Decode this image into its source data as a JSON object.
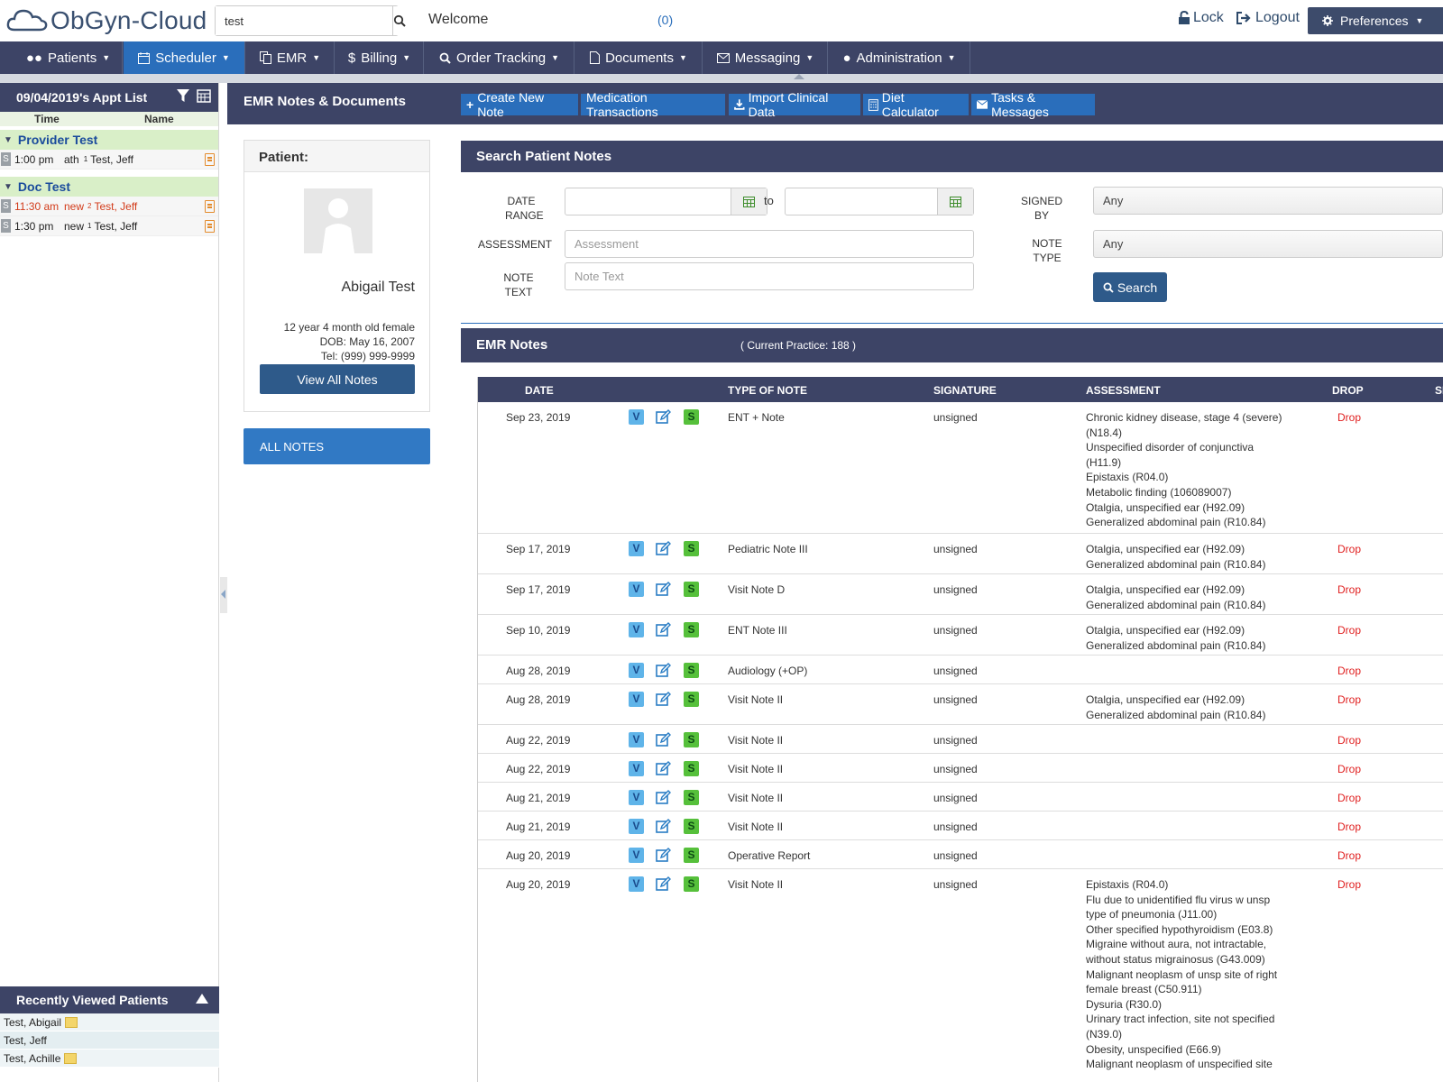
{
  "app": {
    "logo_text": "ObGyn-Cloud"
  },
  "header": {
    "search_value": "test",
    "welcome": "Welcome",
    "messages": "(0)",
    "lock": "Lock",
    "logout": "Logout",
    "preferences": "Preferences"
  },
  "nav": {
    "patients": "Patients",
    "scheduler": "Scheduler",
    "emr": "EMR",
    "billing": "Billing",
    "order_tracking": "Order Tracking",
    "documents": "Documents",
    "messaging": "Messaging",
    "administration": "Administration"
  },
  "sidebar": {
    "title": "09/04/2019's Appt List",
    "col_time": "Time",
    "col_name": "Name",
    "groups": [
      {
        "name": "Provider Test",
        "rows": [
          {
            "time": "1:00 pm",
            "type": "ath",
            "sup": "1",
            "patient": "Test, Jeff",
            "red": false
          }
        ]
      },
      {
        "name": "Doc Test",
        "rows": [
          {
            "time": "11:30 am",
            "type": "new",
            "sup": "2",
            "patient": "Test, Jeff",
            "red": true
          },
          {
            "time": "1:30 pm",
            "type": "new",
            "sup": "1",
            "patient": "Test, Jeff",
            "red": false
          }
        ]
      }
    ],
    "recent_title": "Recently Viewed Patients",
    "recent": [
      "Test, Abigail",
      "Test, Jeff",
      "Test, Achille"
    ]
  },
  "main": {
    "title": "EMR Notes & Documents",
    "toolbar": {
      "create": "Create New Note",
      "medication": "Medication Transactions",
      "import": "Import Clinical Data",
      "diet": "Diet Calculator",
      "tasks": "Tasks & Messages"
    }
  },
  "patient": {
    "header": "Patient:",
    "name": "Abigail Test",
    "age": "12 year 4 month old female",
    "dob": "DOB: May 16, 2007",
    "tel": "Tel: (999) 999-9999",
    "view_all": "View All Notes",
    "all_notes": "ALL NOTES"
  },
  "search": {
    "title": "Search Patient Notes",
    "date_label_1": "DATE",
    "date_label_2": "RANGE",
    "to": "to",
    "assessment_label": "ASSESSMENT",
    "assessment_placeholder": "Assessment",
    "note_label_1": "NOTE",
    "note_label_2": "TEXT",
    "note_placeholder": "Note Text",
    "signed_label_1": "SIGNED",
    "signed_label_2": "BY",
    "signed_value": "Any",
    "type_label_1": "NOTE",
    "type_label_2": "TYPE",
    "type_value": "Any",
    "button": "Search"
  },
  "emr": {
    "title": "EMR Notes",
    "practice": "( Current Practice: 188 )",
    "columns": {
      "date": "DATE",
      "type": "TYPE OF NOTE",
      "signature": "SIGNATURE",
      "assessment": "ASSESSMENT",
      "drop": "DROP",
      "s": "SI"
    },
    "rows": [
      {
        "date": "Sep 23, 2019",
        "type": "ENT + Note",
        "signature": "unsigned",
        "drop": "Drop",
        "assessment": [
          "Chronic kidney disease, stage 4 (severe)",
          "(N18.4)",
          "Unspecified disorder of conjunctiva",
          "(H11.9)",
          "Epistaxis (R04.0)",
          "Metabolic finding (106089007)",
          "Otalgia, unspecified ear (H92.09)",
          "Generalized abdominal pain (R10.84)"
        ]
      },
      {
        "date": "Sep 17, 2019",
        "type": "Pediatric Note III",
        "signature": "unsigned",
        "drop": "Drop",
        "assessment": [
          "Otalgia, unspecified ear (H92.09)",
          "Generalized abdominal pain (R10.84)"
        ]
      },
      {
        "date": "Sep 17, 2019",
        "type": "Visit Note D",
        "signature": "unsigned",
        "drop": "Drop",
        "assessment": [
          "Otalgia, unspecified ear (H92.09)",
          "Generalized abdominal pain (R10.84)"
        ]
      },
      {
        "date": "Sep 10, 2019",
        "type": "ENT Note III",
        "signature": "unsigned",
        "drop": "Drop",
        "assessment": [
          "Otalgia, unspecified ear (H92.09)",
          "Generalized abdominal pain (R10.84)"
        ]
      },
      {
        "date": "Aug 28, 2019",
        "type": "Audiology (+OP)",
        "signature": "unsigned",
        "drop": "Drop",
        "assessment": []
      },
      {
        "date": "Aug 28, 2019",
        "type": "Visit Note II",
        "signature": "unsigned",
        "drop": "Drop",
        "assessment": [
          "Otalgia, unspecified ear (H92.09)",
          "Generalized abdominal pain (R10.84)"
        ]
      },
      {
        "date": "Aug 22, 2019",
        "type": "Visit Note II",
        "signature": "unsigned",
        "drop": "Drop",
        "assessment": []
      },
      {
        "date": "Aug 22, 2019",
        "type": "Visit Note II",
        "signature": "unsigned",
        "drop": "Drop",
        "assessment": []
      },
      {
        "date": "Aug 21, 2019",
        "type": "Visit Note II",
        "signature": "unsigned",
        "drop": "Drop",
        "assessment": []
      },
      {
        "date": "Aug 21, 2019",
        "type": "Visit Note II",
        "signature": "unsigned",
        "drop": "Drop",
        "assessment": []
      },
      {
        "date": "Aug 20, 2019",
        "type": "Operative Report",
        "signature": "unsigned",
        "drop": "Drop",
        "assessment": []
      },
      {
        "date": "Aug 20, 2019",
        "type": "Visit Note II",
        "signature": "unsigned",
        "drop": "Drop",
        "assessment": [
          "Epistaxis (R04.0)",
          "Flu due to unidentified flu virus w unsp",
          "type of pneumonia (J11.00)",
          "Other specified hypothyroidism (E03.8)",
          "Migraine without aura, not intractable,",
          "without status migrainosus (G43.009)",
          "Malignant neoplasm of unsp site of right",
          "female breast (C50.911)",
          "Dysuria (R30.0)",
          "Urinary tract infection, site not specified",
          "(N39.0)",
          "Obesity, unspecified (E66.9)",
          "Malignant neoplasm of unspecified site"
        ]
      }
    ]
  }
}
